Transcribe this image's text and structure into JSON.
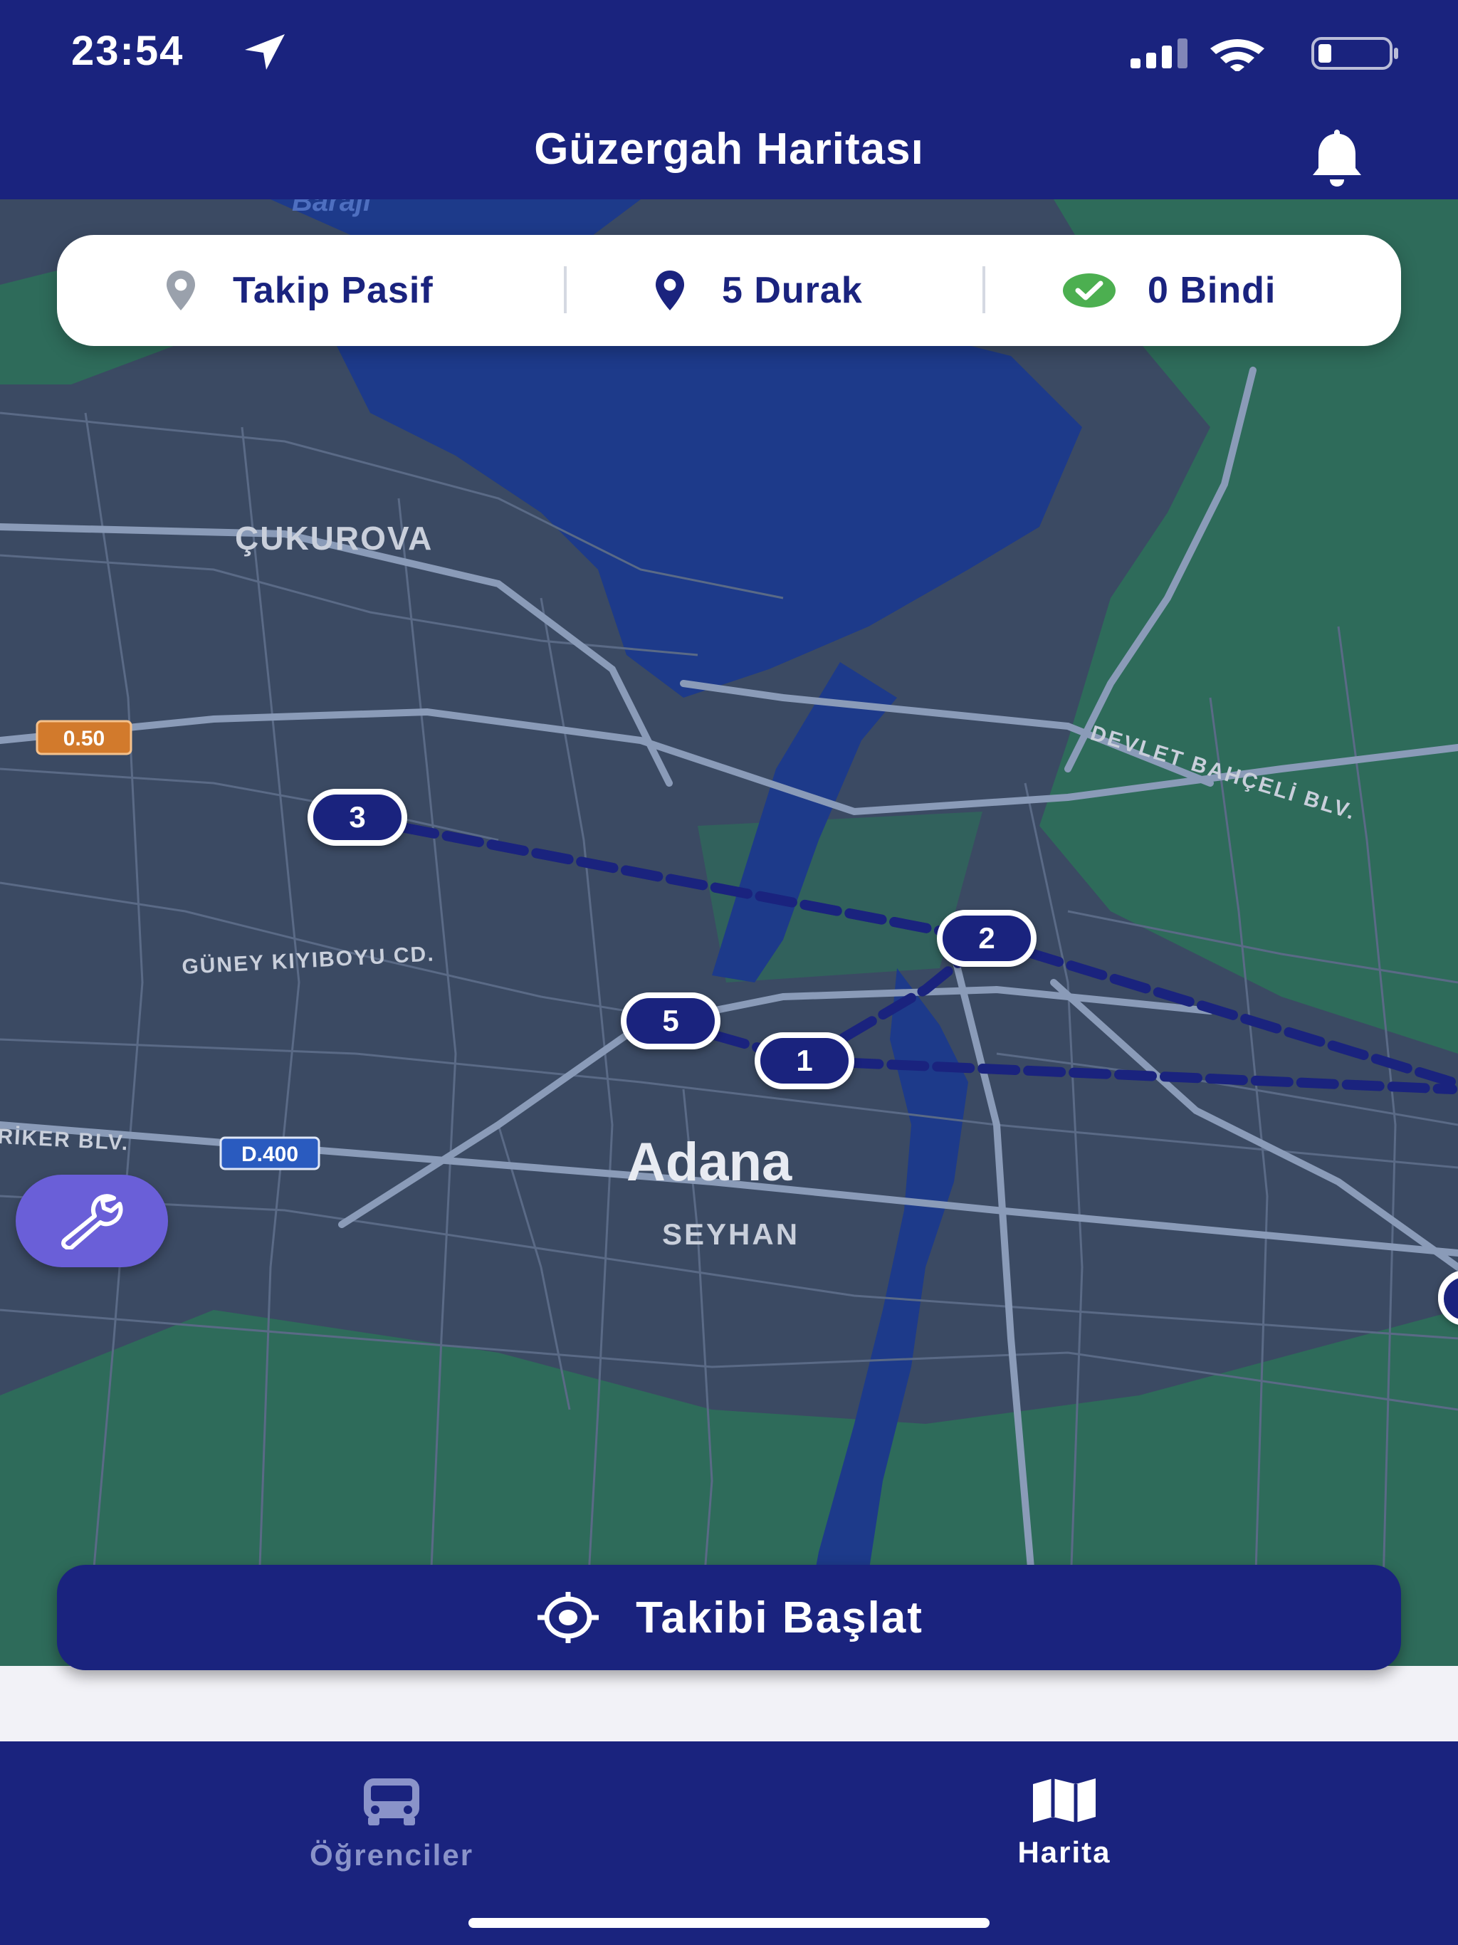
{
  "status_bar": {
    "time": "23:54",
    "icons": [
      "location-arrow-icon",
      "cellular-signal-icon",
      "wifi-icon",
      "battery-icon"
    ]
  },
  "header": {
    "title": "Güzergah Haritası",
    "icon": "bell-icon"
  },
  "stats": {
    "tracking": {
      "label": "Takip Pasif",
      "icon": "map-pin-icon",
      "color": "#9aa1ac"
    },
    "stops": {
      "label": "5 Durak",
      "icon": "map-pin-icon",
      "color": "#1a237e"
    },
    "boarded": {
      "label": "0 Bindi",
      "icon": "check-circle-icon",
      "color": "#4caf50"
    }
  },
  "map": {
    "labels": {
      "district_cukurova": "ÇUKUROVA",
      "city": "Adana",
      "district_seyhan": "SEYHAN",
      "road_devlet": "DEVLET BAHÇELİ BLV.",
      "road_guney": "GÜNEY KIYIBOYU CD.",
      "road_riker": "RİKER BLV.",
      "dam": "Barajı"
    },
    "road_shields": [
      "0.50",
      "D.400"
    ],
    "stops": [
      {
        "number": "1"
      },
      {
        "number": "2"
      },
      {
        "number": "3"
      },
      {
        "number": "5"
      }
    ],
    "colors": {
      "land": "#3b4a63",
      "water": "#1d3a8a",
      "green": "#2e6b5a",
      "route": "#1a237e"
    }
  },
  "tool_button": {
    "icon": "wrench-icon",
    "color": "#6a5fd8"
  },
  "start_button": {
    "label": "Takibi Başlat",
    "icon": "location-target-icon"
  },
  "tabs": [
    {
      "label": "Öğrenciler",
      "icon": "bus-icon",
      "active": false
    },
    {
      "label": "Harita",
      "icon": "map-icon",
      "active": true
    }
  ],
  "theme": {
    "primary": "#1a237e",
    "inactive_tab": "#8a93c9"
  }
}
